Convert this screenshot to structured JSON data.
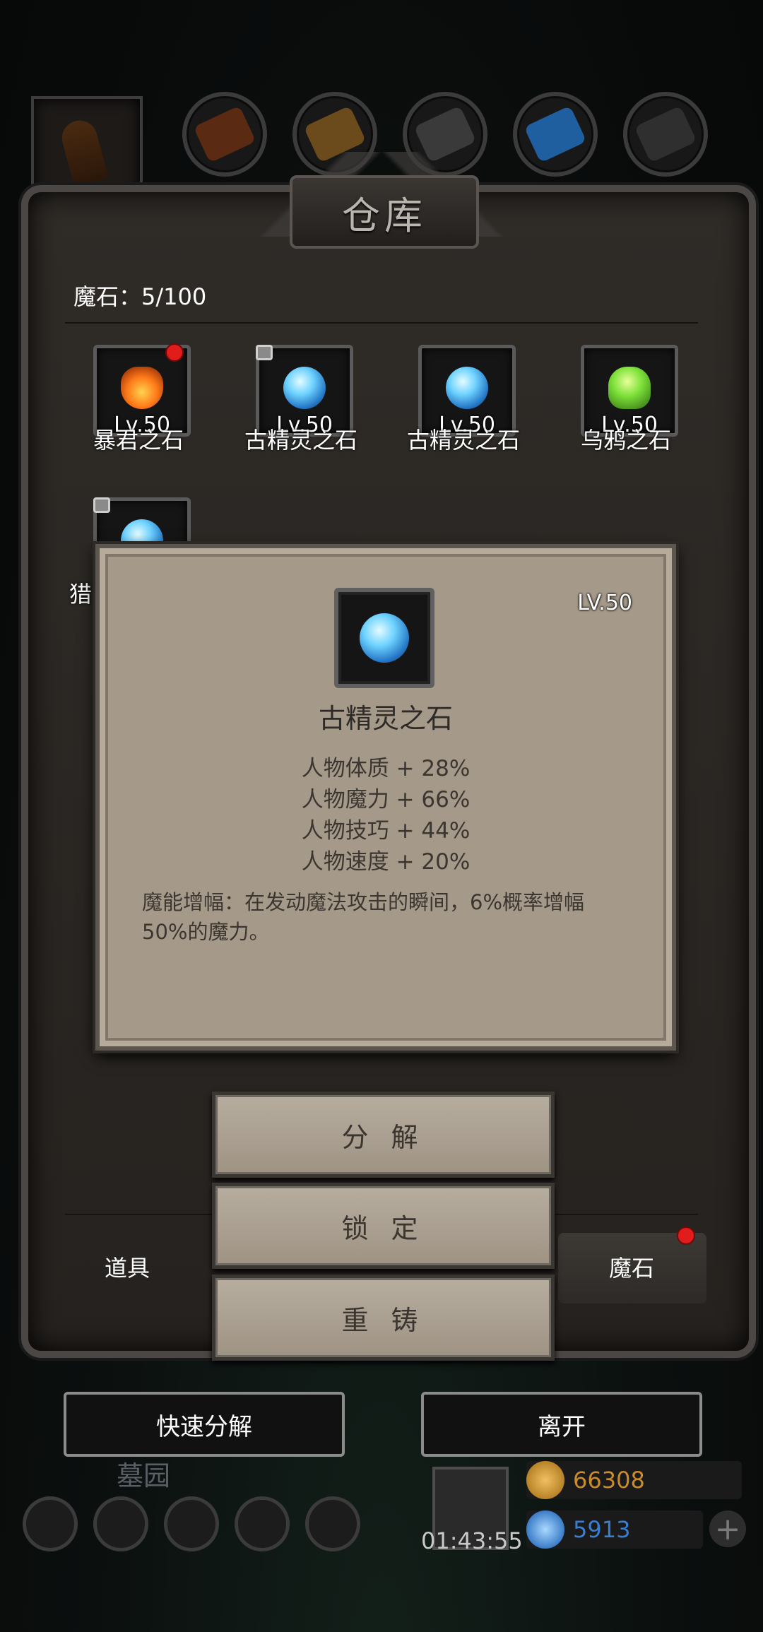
{
  "title": "仓库",
  "stone_count": "魔石：5/100",
  "items": [
    {
      "name": "暴君之石",
      "level": "Lv.50",
      "gem": "fire-stone",
      "color": "#ff7a1a",
      "badge": true,
      "locked": false
    },
    {
      "name": "古精灵之石",
      "level": "Lv.50",
      "gem": "elf-stone",
      "color": "#5fd0ff",
      "badge": false,
      "locked": true
    },
    {
      "name": "古精灵之石",
      "level": "Lv.50",
      "gem": "elf-stone",
      "color": "#5fd0ff",
      "badge": false,
      "locked": false
    },
    {
      "name": "乌鸦之石",
      "level": "Lv.50",
      "gem": "crow-stone",
      "color": "#7ee23a",
      "badge": false,
      "locked": false
    },
    {
      "name": "猎",
      "level": "",
      "gem": "hunter-stone",
      "color": "#5fd0ff",
      "badge": false,
      "locked": true
    }
  ],
  "popup": {
    "level": "LV.50",
    "name": "古精灵之石",
    "stats": [
      "人物体质 + 28%",
      "人物魔力 + 66%",
      "人物技巧 + 44%",
      "人物速度 + 20%"
    ],
    "description": "魔能增幅：在发动魔法攻击的瞬间，6%概率增幅50%的魔力。"
  },
  "actions": {
    "decompose": "分 解",
    "lock": "锁 定",
    "reforge": "重 铸"
  },
  "tabs": {
    "items": "道具",
    "magic_stone": "魔石"
  },
  "bottom_buttons": {
    "quick_decompose": "快速分解",
    "leave": "离开"
  },
  "hud": {
    "area": "墓园",
    "timer": "01:43:55",
    "gold": "66308",
    "gems": "5913",
    "gold_color": "#c98b2b",
    "gem_color": "#3a7fcf"
  }
}
